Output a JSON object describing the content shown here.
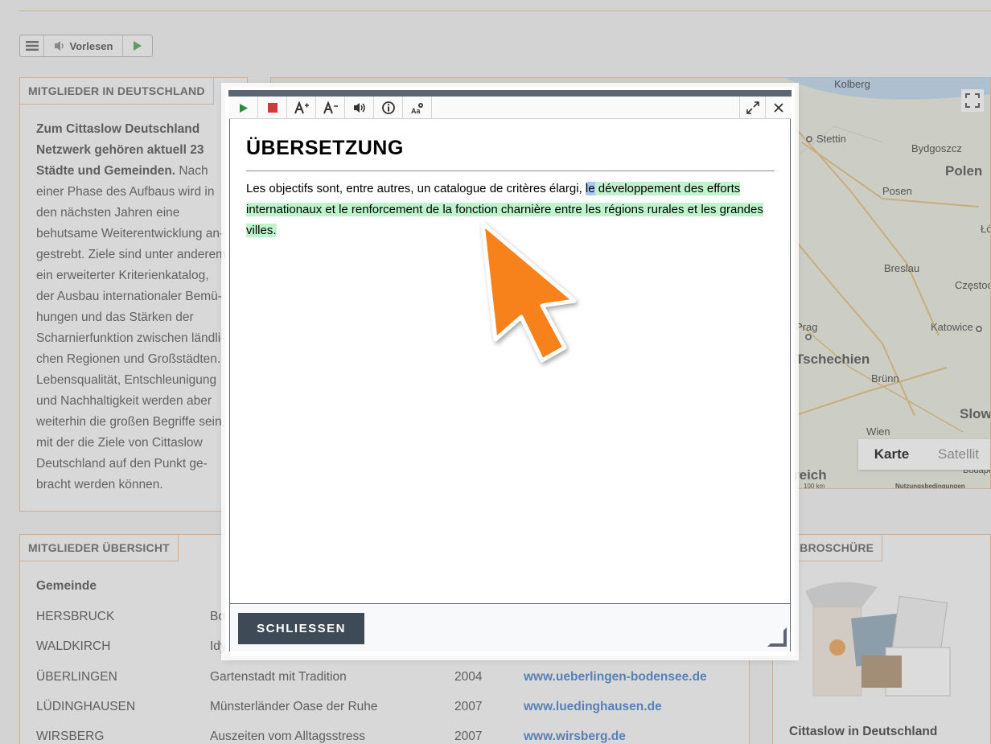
{
  "readspeaker": {
    "read_label": "Vorlesen"
  },
  "panel_members_de": {
    "tab": "MITGLIEDER IN DEUTSCHLAND",
    "lead": "Zum Cittaslow Deutschland Netzwerk gehören aktuell 23 Städte und Gemeinden.",
    "body": "Nach einer Phase des Aufbaus wird in den nächsten Jahren eine behutsame Weiterentwicklung an-gestrebt. Ziele sind unter anderem ein erweiterter Kriterienkatalog, der Ausbau internationaler Bemü-hungen und das Stärken der Scharnierfunktion zwischen ländli-chen Regionen und Großstädten. Lebensqualität, Entschleunigung und Nachhaltigkeit werden aber weiterhin die großen Begriffe sein, mit der die Ziele von Cittaslow Deutschland auf den Punkt ge-bracht werden können."
  },
  "map": {
    "labels": [
      "Kolberg",
      "Stettin",
      "Bydgoszcz",
      "Polen",
      "Posen",
      "Łó",
      "Breslau",
      "Częstoch",
      "Prag",
      "Katowice",
      "Tschechien",
      "Brünn",
      "Slow",
      "Wien",
      "reich",
      "Budape"
    ],
    "btn_map": "Karte",
    "btn_sat": "Satellit",
    "scale": "100 km",
    "terms": "Nutzungsbedingungen"
  },
  "panel_overview": {
    "tab": "MITGLIEDER ÜBERSICHT",
    "col_header": "Gemeinde",
    "rows": [
      {
        "name": "HERSBRUCK",
        "motto": "Bot",
        "year": "",
        "url": ""
      },
      {
        "name": "WALDKIRCH",
        "motto": "Idy",
        "year": "",
        "url": ""
      },
      {
        "name": "ÜBERLINGEN",
        "motto": "Gartenstadt mit Tradition",
        "year": "2004",
        "url": "www.ueberlingen-bodensee.de"
      },
      {
        "name": "LÜDINGHAUSEN",
        "motto": "Münsterländer Oase der Ruhe",
        "year": "2007",
        "url": "www.luedinghausen.de"
      },
      {
        "name": "WIRSBERG",
        "motto": "Auszeiten vom Alltagsstress",
        "year": "2007",
        "url": "www.wirsberg.de"
      }
    ]
  },
  "panel_brochure": {
    "tab": "DF BROSCHÜRE",
    "caption": "Cittaslow in Deutschland"
  },
  "modal": {
    "title": "ÜBERSETZUNG",
    "text_before": "Les objectifs sont, entre autres, un catalogue de critères élargi, ",
    "text_current_word": "le",
    "text_highlighted": " développement des efforts internationaux et le renforcement de la fonction charnière entre les régions rurales et les grandes villes.",
    "close_label": "SCHLIESSEN",
    "toolbar": [
      "play-icon",
      "stop-icon",
      "font-increase-icon",
      "font-decrease-icon",
      "volume-icon",
      "info-icon",
      "text-settings-icon",
      "expand-icon",
      "close-icon"
    ],
    "colors": {
      "highlight": "#bff3cc",
      "word_highlight": "#a9c8f3",
      "button": "#3f4a57",
      "cursor": "#f7821b"
    }
  }
}
